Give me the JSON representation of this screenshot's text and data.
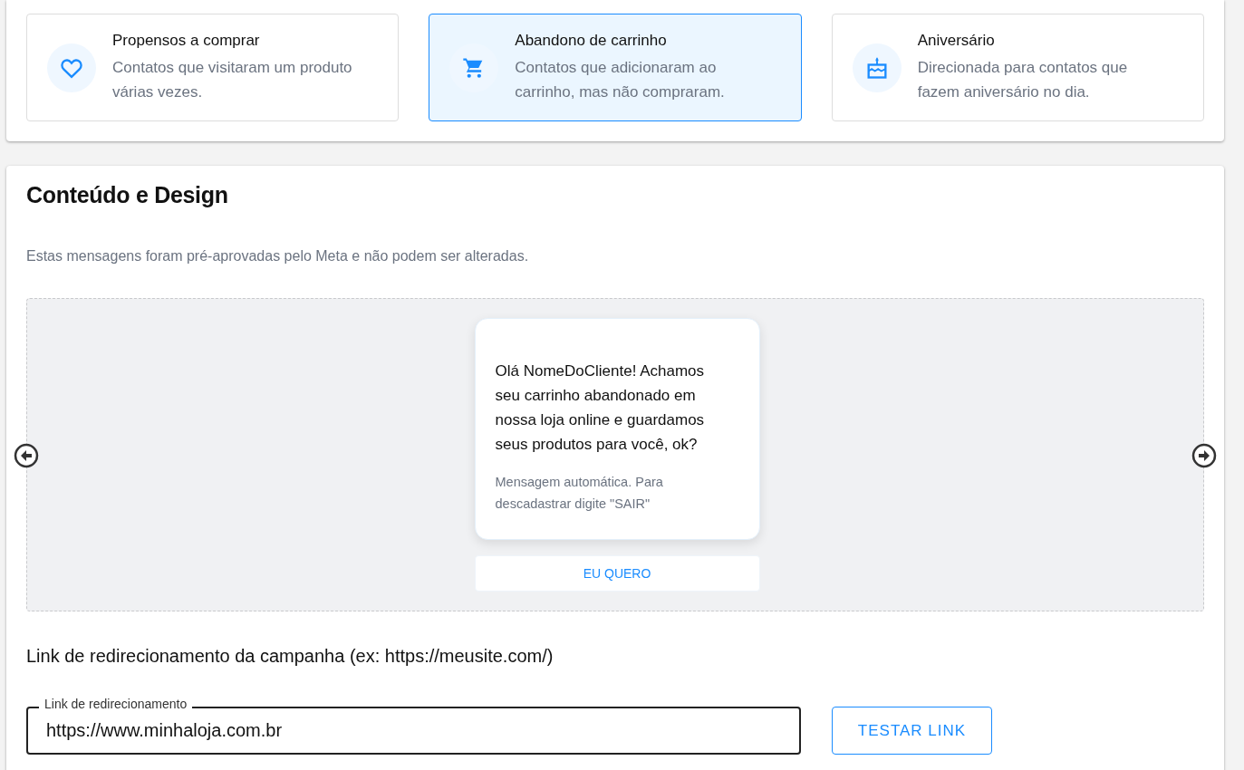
{
  "audiences": [
    {
      "kind": "heart",
      "title": "Propensos a comprar",
      "description": "Contatos que visitaram um produto várias vezes.",
      "selected": false
    },
    {
      "kind": "cart",
      "title": "Abandono de carrinho",
      "description": "Contatos que adicionaram ao carrinho, mas não compraram.",
      "selected": true
    },
    {
      "kind": "cake",
      "title": "Aniversário",
      "description": "Direcionada para contatos que fazem aniversário no dia.",
      "selected": false
    }
  ],
  "content": {
    "title": "Conteúdo e Design",
    "note": "Estas mensagens foram pré-aprovadas pelo Meta e não podem ser alteradas.",
    "message": {
      "body": "Olá NomeDoCliente! Achamos seu carrinho abandonado em nossa loja online e guardamos seus produtos para você, ok?",
      "footer": "Mensagem automática. Para descadastrar digite \"SAIR\"",
      "button": "EU QUERO"
    },
    "link_prompt": "Link de redirecionamento da campanha (ex: https://meusite.com/)",
    "link_field": {
      "label": "Link de redirecionamento",
      "value": "https://www.minhaloja.com.br"
    },
    "test_button": "TESTAR LINK"
  }
}
